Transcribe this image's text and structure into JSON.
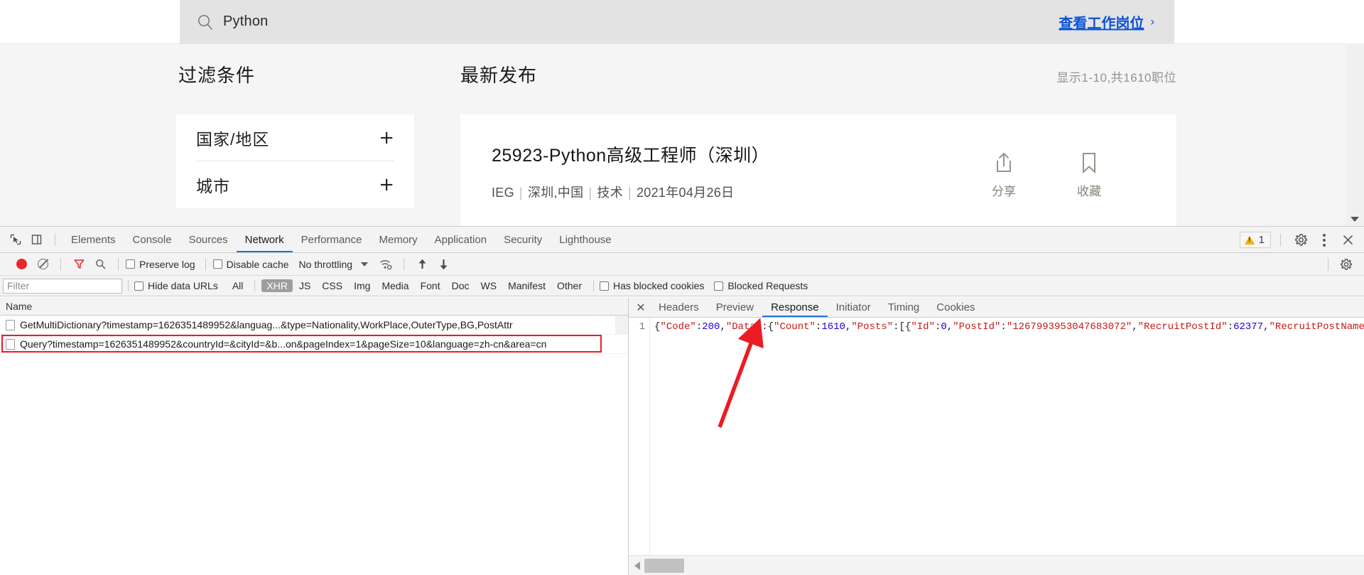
{
  "page": {
    "search": {
      "icon": "search-icon",
      "value": "Python",
      "placeholder": ""
    },
    "view_jobs_link": {
      "label": "查看工作岗位",
      "chevron": "›"
    },
    "filters": {
      "heading": "过滤条件",
      "rows": [
        {
          "name": "国家/地区",
          "action": "+"
        },
        {
          "name": "城市",
          "action": "+"
        }
      ]
    },
    "results": {
      "heading": "最新发布",
      "count_text": "显示1-10,共1610职位",
      "jobs": [
        {
          "title": "25923-Python高级工程师（深圳）",
          "bu": "IEG",
          "location": "深圳,中国",
          "category": "技术",
          "date": "2021年04月26日",
          "actions": [
            {
              "icon": "share-icon",
              "label": "分享"
            },
            {
              "icon": "bookmark-icon",
              "label": "收藏"
            }
          ]
        }
      ]
    }
  },
  "devtools": {
    "left_icons": [
      {
        "name": "inspect-element-icon"
      },
      {
        "name": "device-toolbar-icon"
      }
    ],
    "tabs": [
      {
        "label": "Elements",
        "active": false
      },
      {
        "label": "Console",
        "active": false
      },
      {
        "label": "Sources",
        "active": false
      },
      {
        "label": "Network",
        "active": true
      },
      {
        "label": "Performance",
        "active": false
      },
      {
        "label": "Memory",
        "active": false
      },
      {
        "label": "Application",
        "active": false
      },
      {
        "label": "Security",
        "active": false
      },
      {
        "label": "Lighthouse",
        "active": false
      }
    ],
    "warning_count": "1",
    "right_icons": [
      {
        "name": "settings-gear-icon"
      },
      {
        "name": "more-options-icon"
      },
      {
        "name": "close-devtools-icon"
      }
    ],
    "network_controls": {
      "record_title": "record-button",
      "clear_title": "clear-button",
      "filter_icon": "filter-icon",
      "search_icon": "search-icon",
      "preserve_log": {
        "label": "Preserve log",
        "checked": false
      },
      "disable_cache": {
        "label": "Disable cache",
        "checked": false
      },
      "throttling": "No throttling",
      "wifi_icon": "network-conditions-icon",
      "import_icon": "import-har-icon",
      "export_icon": "export-har-icon",
      "settings_icon": "network-settings-icon"
    },
    "filter_bar": {
      "input_placeholder": "Filter",
      "input_value": "",
      "hide_data_urls": {
        "label": "Hide data URLs",
        "checked": false
      },
      "types": [
        {
          "label": "All",
          "active": false
        },
        {
          "label": "XHR",
          "active": true
        },
        {
          "label": "JS",
          "active": false
        },
        {
          "label": "CSS",
          "active": false
        },
        {
          "label": "Img",
          "active": false
        },
        {
          "label": "Media",
          "active": false
        },
        {
          "label": "Font",
          "active": false
        },
        {
          "label": "Doc",
          "active": false
        },
        {
          "label": "WS",
          "active": false
        },
        {
          "label": "Manifest",
          "active": false
        },
        {
          "label": "Other",
          "active": false
        }
      ],
      "has_blocked_cookies": {
        "label": "Has blocked cookies",
        "checked": false
      },
      "blocked_requests": {
        "label": "Blocked Requests",
        "checked": false
      }
    },
    "request_list": {
      "column_header": "Name",
      "rows": [
        {
          "name": "GetMultiDictionary?timestamp=1626351489952&languag...&type=Nationality,WorkPlace,OuterType,BG,PostAttr",
          "selected": false,
          "highlighted": false
        },
        {
          "name": "Query?timestamp=1626351489952&countryId=&cityId=&b...on&pageIndex=1&pageSize=10&language=zh-cn&area=cn",
          "selected": true,
          "highlighted": true
        }
      ]
    },
    "detail_panel": {
      "close_label": "✕",
      "tabs": [
        {
          "label": "Headers",
          "active": false
        },
        {
          "label": "Preview",
          "active": false
        },
        {
          "label": "Response",
          "active": true
        },
        {
          "label": "Initiator",
          "active": false
        },
        {
          "label": "Timing",
          "active": false
        },
        {
          "label": "Cookies",
          "active": false
        }
      ],
      "line_number": "1",
      "response_tokens": [
        {
          "t": "{",
          "c": "punc"
        },
        {
          "t": "\"Code\"",
          "c": "key"
        },
        {
          "t": ":",
          "c": "punc"
        },
        {
          "t": "200",
          "c": "num"
        },
        {
          "t": ",",
          "c": "punc"
        },
        {
          "t": "\"Data\"",
          "c": "key"
        },
        {
          "t": ":{",
          "c": "punc"
        },
        {
          "t": "\"Count\"",
          "c": "key"
        },
        {
          "t": ":",
          "c": "punc"
        },
        {
          "t": "1610",
          "c": "num"
        },
        {
          "t": ",",
          "c": "punc"
        },
        {
          "t": "\"Posts\"",
          "c": "key"
        },
        {
          "t": ":[{",
          "c": "punc"
        },
        {
          "t": "\"Id\"",
          "c": "key"
        },
        {
          "t": ":",
          "c": "punc"
        },
        {
          "t": "0",
          "c": "num"
        },
        {
          "t": ",",
          "c": "punc"
        },
        {
          "t": "\"PostId\"",
          "c": "key"
        },
        {
          "t": ":",
          "c": "punc"
        },
        {
          "t": "\"1267993953047683072\"",
          "c": "str"
        },
        {
          "t": ",",
          "c": "punc"
        },
        {
          "t": "\"RecruitPostId\"",
          "c": "key"
        },
        {
          "t": ":",
          "c": "punc"
        },
        {
          "t": "62377",
          "c": "num"
        },
        {
          "t": ",",
          "c": "punc"
        },
        {
          "t": "\"RecruitPostName",
          "c": "key"
        }
      ]
    }
  },
  "colors": {
    "accent_blue": "#1a73e8",
    "link_blue": "#0b52d8",
    "record_red": "#e8282b",
    "highlight_red": "#ec1c24",
    "filter_active_red": "#e8282b",
    "warning_yellow": "#f2b200"
  }
}
